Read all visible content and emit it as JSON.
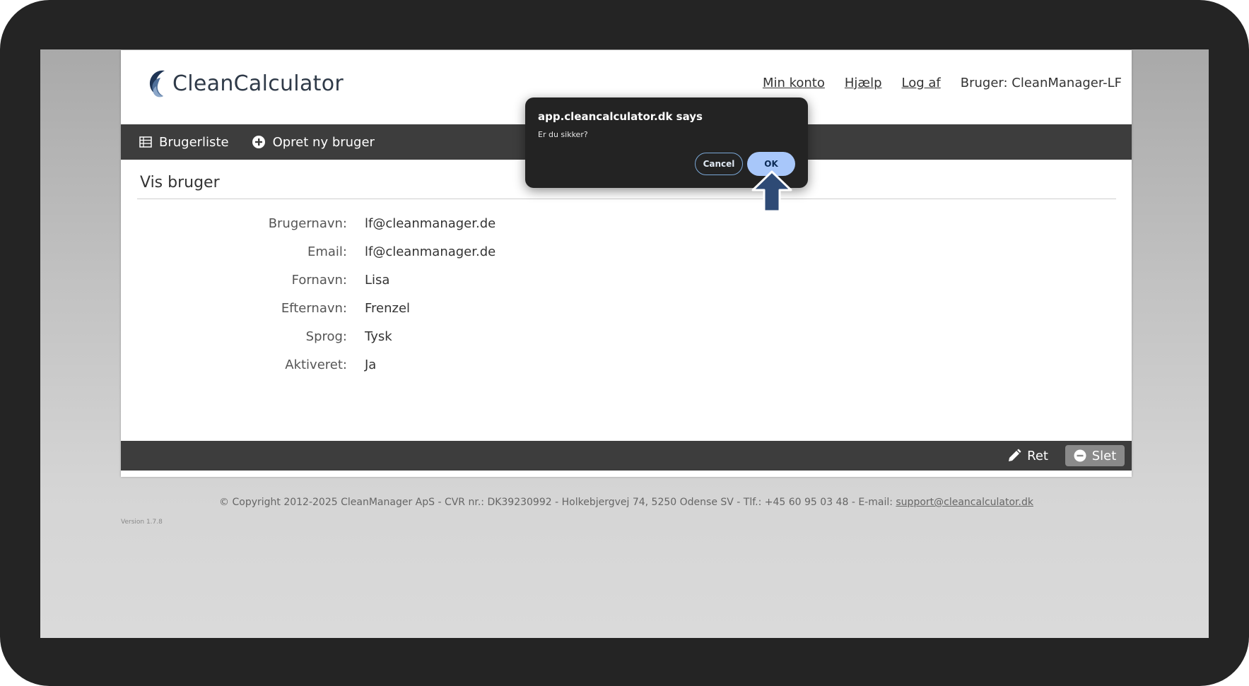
{
  "header": {
    "logo_text": "CleanCalculator",
    "nav": {
      "my_account": "Min konto",
      "help": "Hjælp",
      "logout": "Log af",
      "user": "Bruger: CleanManager-LF"
    }
  },
  "toolbar": {
    "user_list": "Brugerliste",
    "create_user": "Opret ny bruger"
  },
  "content": {
    "title": "Vis bruger",
    "fields": [
      {
        "label": "Brugernavn:",
        "value": "lf@cleanmanager.de"
      },
      {
        "label": "Email:",
        "value": "lf@cleanmanager.de"
      },
      {
        "label": "Fornavn:",
        "value": "Lisa"
      },
      {
        "label": "Efternavn:",
        "value": "Frenzel"
      },
      {
        "label": "Sprog:",
        "value": "Tysk"
      },
      {
        "label": "Aktiveret:",
        "value": "Ja"
      }
    ]
  },
  "actions": {
    "edit": "Ret",
    "delete": "Slet"
  },
  "footer": {
    "copyright": "© Copyright 2012-2025 CleanManager ApS - CVR nr.: DK39230992 - Holkebjergvej 74, 5250 Odense SV - Tlf.: +45 60 95 03 48 - E-mail: ",
    "email": "support@cleancalculator.dk",
    "version": "Version 1.7.8"
  },
  "dialog": {
    "title": "app.cleancalculator.dk says",
    "message": "Er du sikker?",
    "cancel": "Cancel",
    "ok": "OK"
  },
  "colors": {
    "toolbar_bg": "#3d3d3d",
    "ok_button": "#a8c7fa",
    "dialog_bg": "#232323",
    "logo_blue": "#2f4a6e"
  },
  "icons": {
    "user_list": "table-icon",
    "create_user": "plus-circle-icon",
    "edit": "pencil-icon",
    "delete": "minus-circle-icon",
    "logo": "wave-logo-icon",
    "pointer": "arrow-up-icon"
  }
}
